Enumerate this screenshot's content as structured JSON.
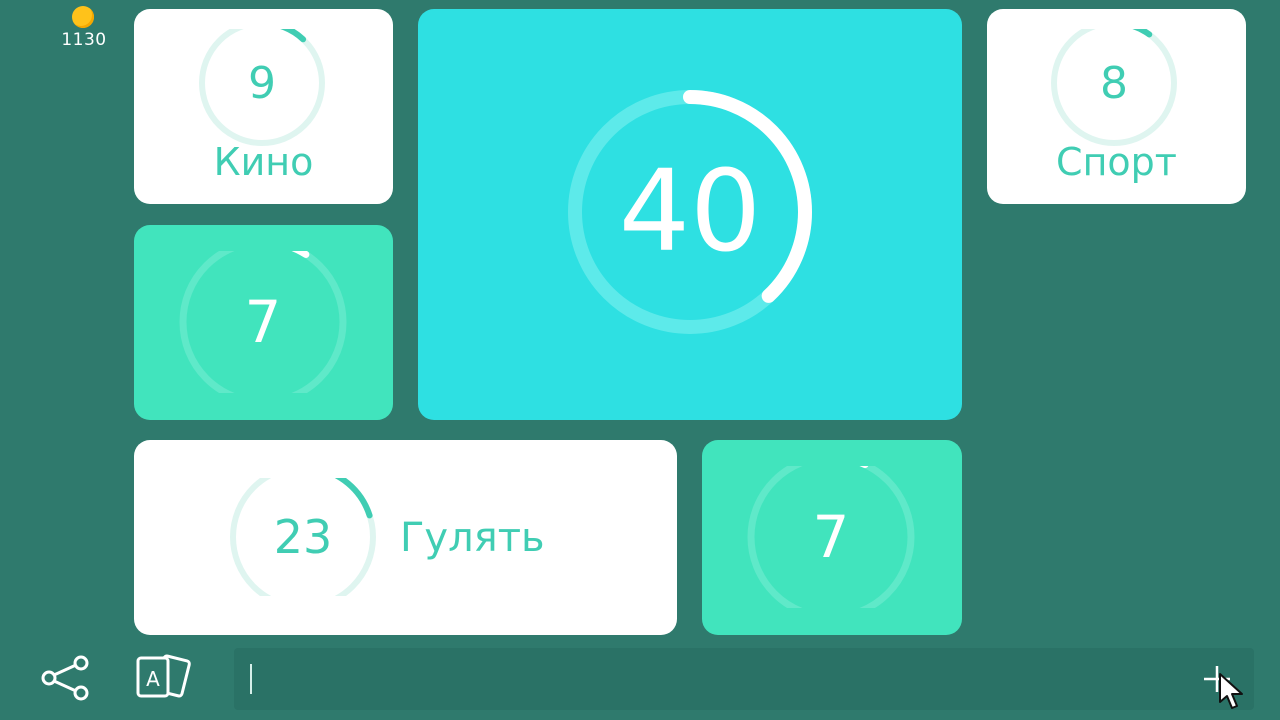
{
  "app": {
    "coins": "1130"
  },
  "colors": {
    "background": "#2f7a6d",
    "tile_white": "#ffffff",
    "tile_mint": "#41e4bd",
    "tile_cyan": "#2ee0e2",
    "accent_text": "#40cdb3",
    "coin": "#ffc21a"
  },
  "tiles": [
    {
      "id": "kino",
      "number": "9",
      "label": "Кино",
      "progress": 0.12,
      "style": "white"
    },
    {
      "id": "main",
      "number": "40",
      "label": "",
      "progress": 0.38,
      "style": "cyan"
    },
    {
      "id": "sport",
      "number": "8",
      "label": "Спорт",
      "progress": 0.1,
      "style": "white"
    },
    {
      "id": "left-mint",
      "number": "7",
      "label": "",
      "progress": 0.09,
      "style": "mint"
    },
    {
      "id": "gulyat",
      "number": "23",
      "label": "Гулять",
      "progress": 0.2,
      "style": "white"
    },
    {
      "id": "bottom-mint",
      "number": "7",
      "label": "",
      "progress": 0.07,
      "style": "mint"
    }
  ],
  "toolbar": {
    "share_icon": "share-icon",
    "cards_icon": "cards-icon",
    "add_icon": "plus-icon"
  },
  "answer": {
    "value": "",
    "placeholder": ""
  }
}
